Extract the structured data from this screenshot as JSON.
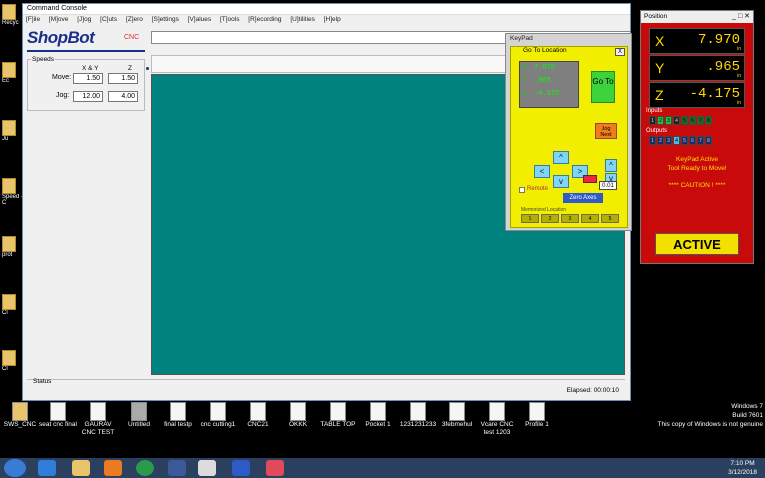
{
  "desktop_left": {
    "items": [
      "Recyc",
      "Ec",
      "Ju",
      "Speed - C",
      "prot",
      "Cl",
      "Cl"
    ]
  },
  "console": {
    "title": "Command Console",
    "menu": [
      "[F]ile",
      "[M]ove",
      "[J]og",
      "[C]uts",
      "[Z]ero",
      "[S]ettings",
      "[V]alues",
      "[T]ools",
      "[R]ecording",
      "[U]tilities",
      "[H]elp"
    ],
    "logo": "ShopBot",
    "logo_sub": "CNC",
    "speeds": {
      "legend": "Speeds",
      "col_xy": "X & Y",
      "col_z": "Z",
      "move_label": "Move:",
      "jog_label": "Jog:",
      "move_xy": "1.50",
      "move_z": "1.50",
      "jog_xy": "12.00",
      "jog_z": "4.00"
    },
    "status_label": "Status",
    "elapsed": "Elapsed: 00:00:10"
  },
  "keypad": {
    "title": "KeyPad",
    "heading": "Go To Location",
    "close": "X",
    "rows": [
      {
        "axis": "X",
        "value": "7.970"
      },
      {
        "axis": "Y",
        "value": ".965"
      },
      {
        "axis": "Z",
        "value": "-4.175"
      }
    ],
    "go_label": "Go To",
    "jog_next": "Jog Next",
    "remote": "Remote",
    "zero_axes": "Zero Axes",
    "step": "0.01",
    "memorized": "Memorized Location",
    "mem": [
      "1",
      "2",
      "3",
      "4",
      "5"
    ]
  },
  "position": {
    "title": "Position",
    "title_controls": "_ □ ✕",
    "axes": [
      {
        "name": "X",
        "value": "7.970",
        "unit": "in"
      },
      {
        "name": "Y",
        "value": ".965",
        "unit": "in"
      },
      {
        "name": "Z",
        "value": "-4.175",
        "unit": "in"
      }
    ],
    "inputs_label": "Inputs",
    "inputs": [
      "1",
      "2",
      "3",
      "4",
      "5",
      "6",
      "7",
      "8"
    ],
    "outputs_label": "Outputs",
    "outputs": [
      "1",
      "2",
      "3",
      "4",
      "5",
      "6",
      "7",
      "8"
    ],
    "msg1": "KeyPad Active",
    "msg2": "Tool Ready to Move!",
    "msg3": "**** CAUTION ! ****",
    "active": "ACTIVE",
    "colors": {
      "panel": "#c80a0a",
      "digits": "#ffd800",
      "active_bg": "#f2e000"
    }
  },
  "desktop_icons": [
    {
      "label": "SWS_CNC"
    },
    {
      "label": "seat cnc final"
    },
    {
      "label": "GAURAV CNC TEST"
    },
    {
      "label": "Untitled"
    },
    {
      "label": "final testp"
    },
    {
      "label": "cnc cutting1"
    },
    {
      "label": "CNC21"
    },
    {
      "label": "OKKK"
    },
    {
      "label": "TABLE TOP"
    },
    {
      "label": "Pocket 1"
    },
    {
      "label": "1231231233"
    },
    {
      "label": "3febmehul"
    },
    {
      "label": "Vcare CNC test 1203"
    },
    {
      "label": "Profile 1"
    }
  ],
  "windows_info": {
    "line1": "Windows 7",
    "line2": "Build 7601",
    "line3": "This copy of Windows is not genuine"
  },
  "taskbar": {
    "time": "7:10 PM",
    "date": "3/12/2018"
  }
}
